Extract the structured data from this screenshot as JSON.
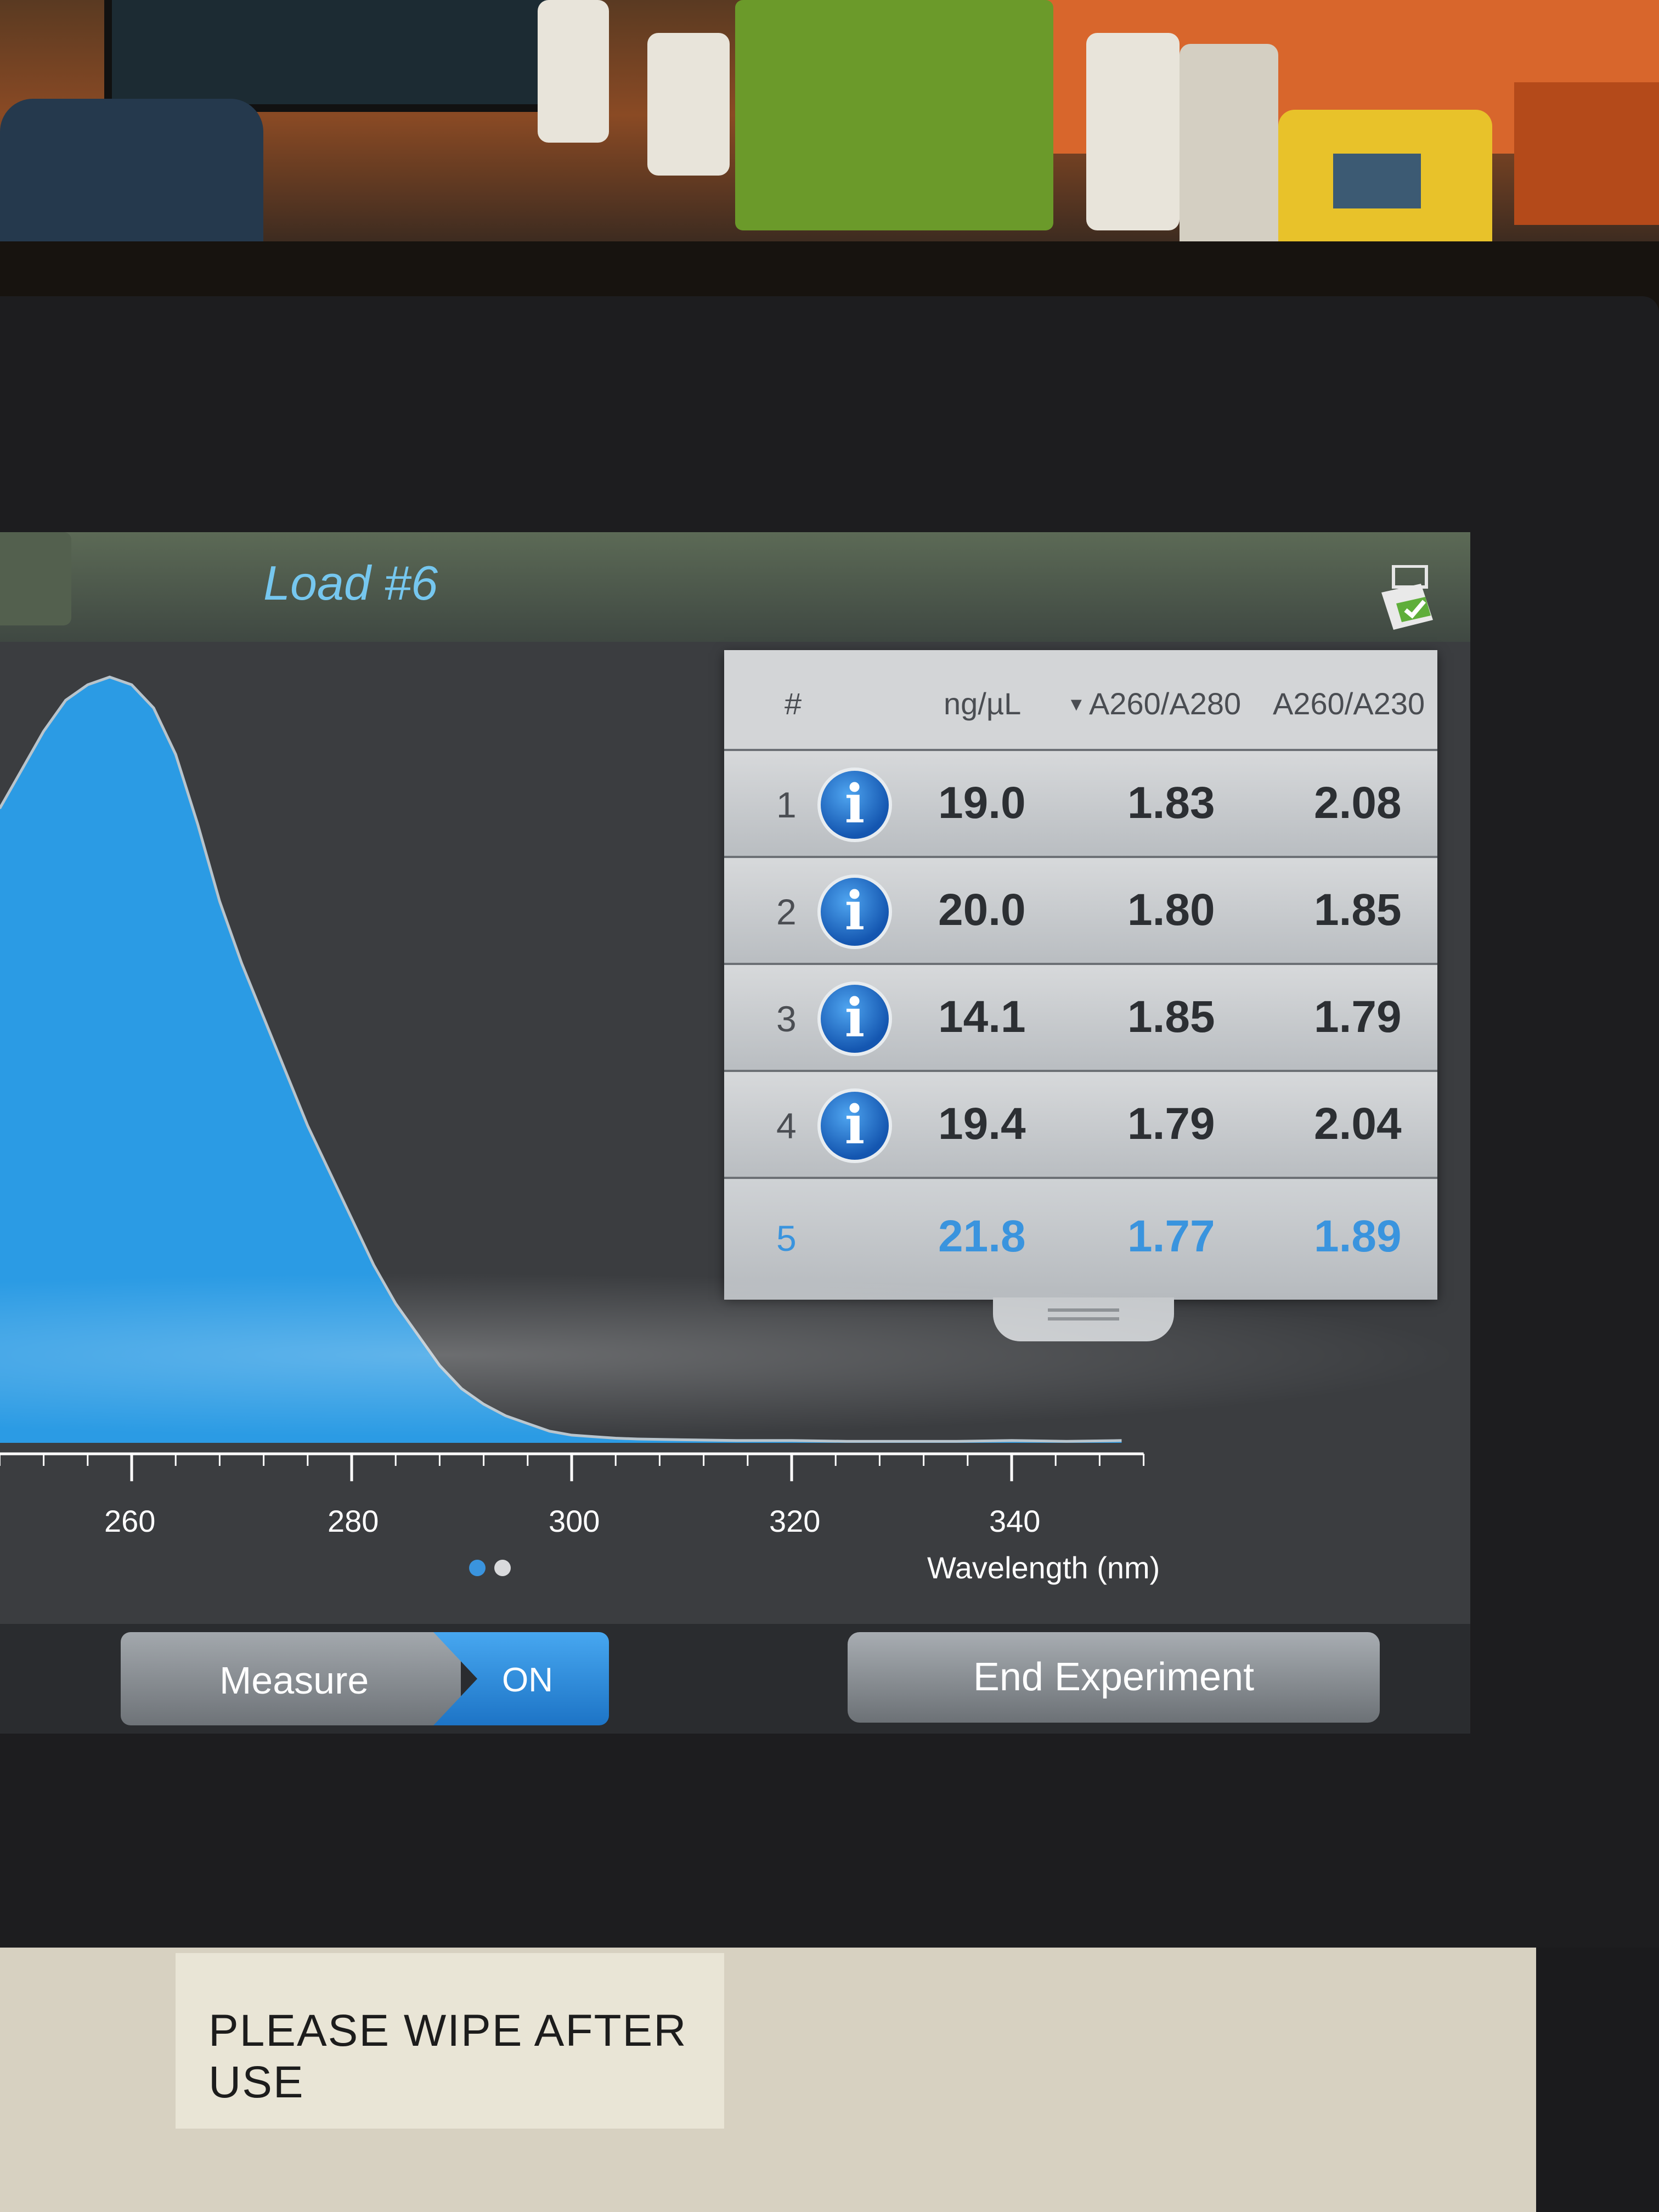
{
  "header": {
    "title": "Load #6"
  },
  "results": {
    "columns": [
      "#",
      "ng/µL",
      "A260/A280",
      "A260/A230"
    ],
    "rows": [
      {
        "num": "1",
        "conc": "19.0",
        "a260_280": "1.83",
        "a260_230": "2.08",
        "has_info": true
      },
      {
        "num": "2",
        "conc": "20.0",
        "a260_280": "1.80",
        "a260_230": "1.85",
        "has_info": true
      },
      {
        "num": "3",
        "conc": "14.1",
        "a260_280": "1.85",
        "a260_230": "1.79",
        "has_info": true
      },
      {
        "num": "4",
        "conc": "19.4",
        "a260_280": "1.79",
        "a260_230": "2.04",
        "has_info": true
      },
      {
        "num": "5",
        "conc": "21.8",
        "a260_280": "1.77",
        "a260_230": "1.89",
        "has_info": false,
        "active": true
      }
    ],
    "info_icon": "info-icon"
  },
  "chart_data": {
    "type": "area",
    "xlabel": "Wavelength (nm)",
    "xticks": [
      260,
      280,
      300,
      320,
      340
    ],
    "xlim": [
      248,
      352
    ],
    "ylim": [
      0,
      1.0
    ],
    "color": "#2b9be4",
    "series": [
      {
        "x": [
          248,
          250,
          252,
          254,
          256,
          258,
          260,
          262,
          264,
          266,
          268,
          270,
          272,
          274,
          276,
          278,
          280,
          282,
          284,
          286,
          288,
          290,
          292,
          294,
          296,
          298,
          300,
          302,
          304,
          306,
          310,
          315,
          320,
          325,
          330,
          335,
          340,
          345,
          350
        ],
        "y": [
          0.82,
          0.87,
          0.92,
          0.96,
          0.98,
          0.99,
          0.98,
          0.95,
          0.89,
          0.8,
          0.7,
          0.62,
          0.55,
          0.48,
          0.41,
          0.35,
          0.29,
          0.23,
          0.18,
          0.14,
          0.1,
          0.07,
          0.05,
          0.035,
          0.025,
          0.015,
          0.01,
          0.008,
          0.006,
          0.005,
          0.004,
          0.003,
          0.003,
          0.002,
          0.002,
          0.002,
          0.003,
          0.002,
          0.003
        ]
      }
    ]
  },
  "pager": {
    "pages": 2,
    "current": 1
  },
  "toolbar": {
    "measure_label": "Measure",
    "measure_state": "ON",
    "end_label": "End Experiment"
  },
  "sticker": {
    "text": "PLEASE WIPE AFTER USE"
  },
  "colors": {
    "accent": "#3a94de",
    "title": "#76c7ef",
    "spectrum": "#2b9be4"
  }
}
